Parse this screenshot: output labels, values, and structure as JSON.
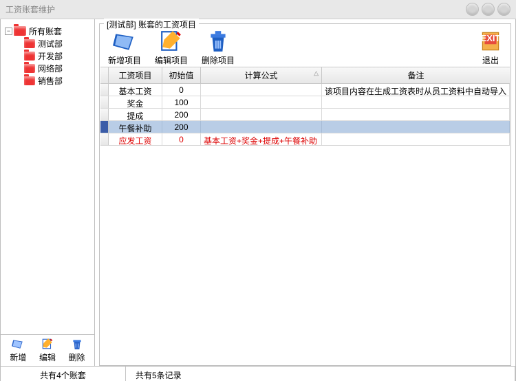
{
  "title": "工资账套维护",
  "tree": {
    "root": "所有账套",
    "items": [
      "测试部",
      "开发部",
      "网络部",
      "销售部"
    ]
  },
  "leftToolbar": {
    "add": "新增",
    "edit": "编辑",
    "delete": "删除"
  },
  "groupTitle": "[测试部] 账套的工资项目",
  "topToolbar": {
    "add": "新增项目",
    "edit": "编辑项目",
    "delete": "删除项目",
    "exit": "退出"
  },
  "table": {
    "headers": {
      "name": "工资项目",
      "init": "初始值",
      "formula": "计算公式",
      "note": "备注"
    },
    "rows": [
      {
        "name": "基本工资",
        "init": "0",
        "formula": "",
        "note": "该项目内容在生成工资表时从员工资料中自动导入",
        "selected": false,
        "red": false
      },
      {
        "name": "奖金",
        "init": "100",
        "formula": "",
        "note": "",
        "selected": false,
        "red": false
      },
      {
        "name": "提成",
        "init": "200",
        "formula": "",
        "note": "",
        "selected": false,
        "red": false
      },
      {
        "name": "午餐补助",
        "init": "200",
        "formula": "",
        "note": "",
        "selected": true,
        "red": false
      },
      {
        "name": "应发工资",
        "init": "0",
        "formula": "基本工资+奖金+提成+午餐补助",
        "note": "",
        "selected": false,
        "red": true
      }
    ]
  },
  "status": {
    "left": "共有4个账套",
    "right": "共有5条记录"
  }
}
